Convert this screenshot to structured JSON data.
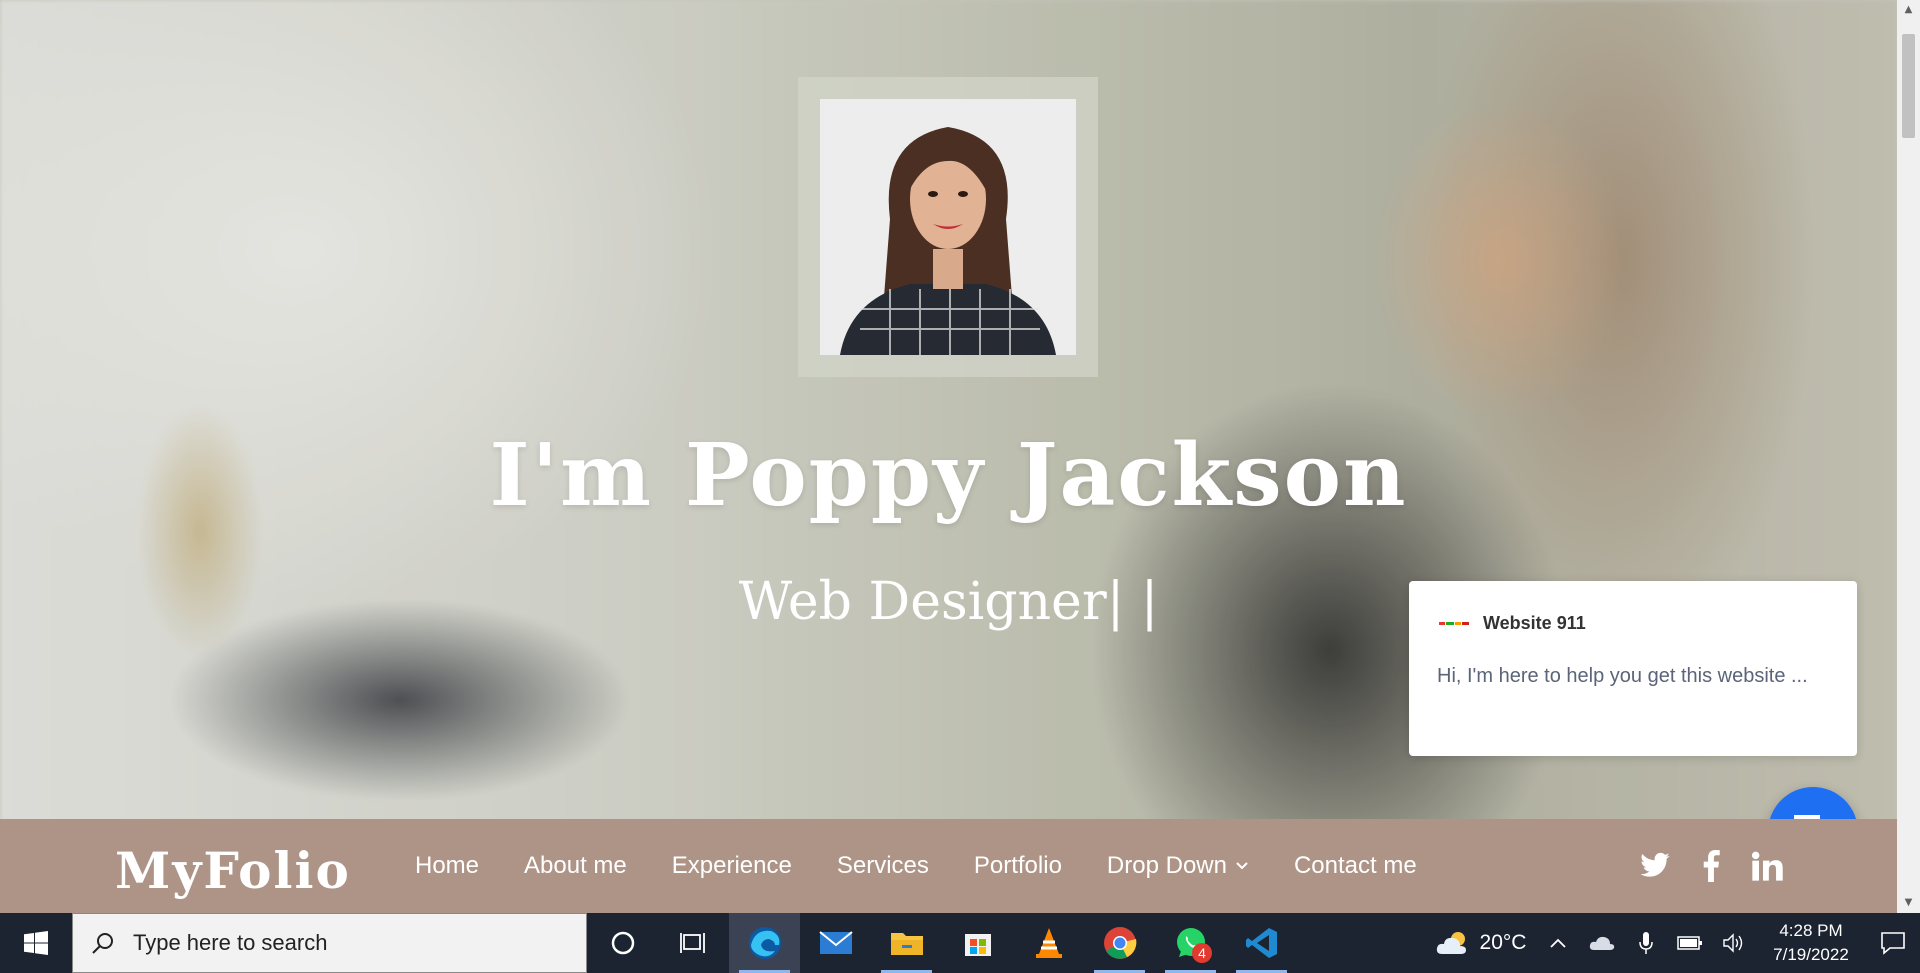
{
  "hero": {
    "title": "I'm Poppy Jackson",
    "subtitle": "Web Designer",
    "cursor": "| |"
  },
  "navbar": {
    "brand": "MyFolio",
    "links": [
      {
        "label": "Home"
      },
      {
        "label": "About me"
      },
      {
        "label": "Experience"
      },
      {
        "label": "Services"
      },
      {
        "label": "Portfolio"
      },
      {
        "label": "Drop Down"
      },
      {
        "label": "Contact me"
      }
    ],
    "socials": [
      "twitter-icon",
      "facebook-icon",
      "linkedin-icon"
    ]
  },
  "chat": {
    "name": "Website 911",
    "message": "Hi, I'm here to help you get this website ..."
  },
  "taskbar": {
    "search_placeholder": "Type here to search",
    "apps": [
      "cortana-icon",
      "task-view-icon",
      "edge-icon",
      "mail-icon",
      "file-explorer-icon",
      "store-icon",
      "vlc-icon",
      "chrome-icon",
      "whatsapp-icon",
      "vscode-icon"
    ],
    "whatsapp_badge": "4",
    "temperature": "20°C",
    "time": "4:28 PM",
    "date": "7/19/2022"
  },
  "colors": {
    "navbar": "#ad9486",
    "chat_button": "#1f6ff2",
    "taskbar": "#1c2331"
  }
}
